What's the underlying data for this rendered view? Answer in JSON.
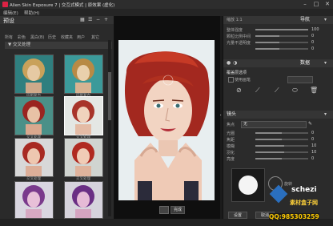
{
  "window": {
    "title": "Alien Skin Exposure 7 | 交互式模式 | 原效果 (虚化)"
  },
  "menu": {
    "items": [
      "编辑(E)",
      "帮助(H)"
    ]
  },
  "left_panel": {
    "title": "预设",
    "tabs": [
      "所有",
      "彩色",
      "黑白(B)",
      "历史",
      "收藏夹",
      "用户",
      "其它"
    ],
    "group": "▼ 交叉处理",
    "thumbs": [
      {
        "label": "印刷复古"
      },
      {
        "label": "印刷复古"
      },
      {
        "label": "交叉处理"
      },
      {
        "label": "交叉处理"
      },
      {
        "label": "交叉处理"
      },
      {
        "label": "交叉处理"
      },
      {
        "label": ""
      },
      {
        "label": ""
      }
    ]
  },
  "center": {
    "zoom": "1:1",
    "done_label": "完成"
  },
  "right_panel": {
    "nav_title": "导航",
    "ratio_label": "缩放 1:1",
    "sliders_top": [
      {
        "label": "整体强度",
        "value": "100",
        "frac": 1.0
      },
      {
        "label": "颗粒比例中间",
        "value": "0",
        "frac": 0.45
      },
      {
        "label": "光量不透明度",
        "value": "0",
        "frac": 0.45
      },
      {
        "label": "",
        "value": "0",
        "frac": 0.45
      }
    ],
    "data_title": "数据",
    "overlay_section": "覆盖层选项",
    "overlay_check": "使用画笔",
    "lens_title": "镜头",
    "lens_sub": "焦点",
    "lens_select": "无",
    "lens_sliders": [
      {
        "label": "光圈",
        "value": "0",
        "frac": 0.5
      },
      {
        "label": "焦距",
        "value": "0",
        "frac": 0.5
      },
      {
        "label": "模糊",
        "value": "10",
        "frac": 0.55
      },
      {
        "label": "羽化",
        "value": "10",
        "frac": 0.55
      },
      {
        "label": "亮度",
        "value": "0",
        "frac": 0.5
      }
    ],
    "settings_label": "设置",
    "cancel_label": "取消",
    "ok_label": "确定",
    "rotate_label": "旋转"
  },
  "watermark": {
    "brand": "schezi",
    "site": "素材盒子网",
    "qq": "QQ:985303259"
  },
  "colors": {
    "accent": "#d24b2c",
    "panel": "#2b2b2b",
    "bg": "#1b1b1b"
  }
}
